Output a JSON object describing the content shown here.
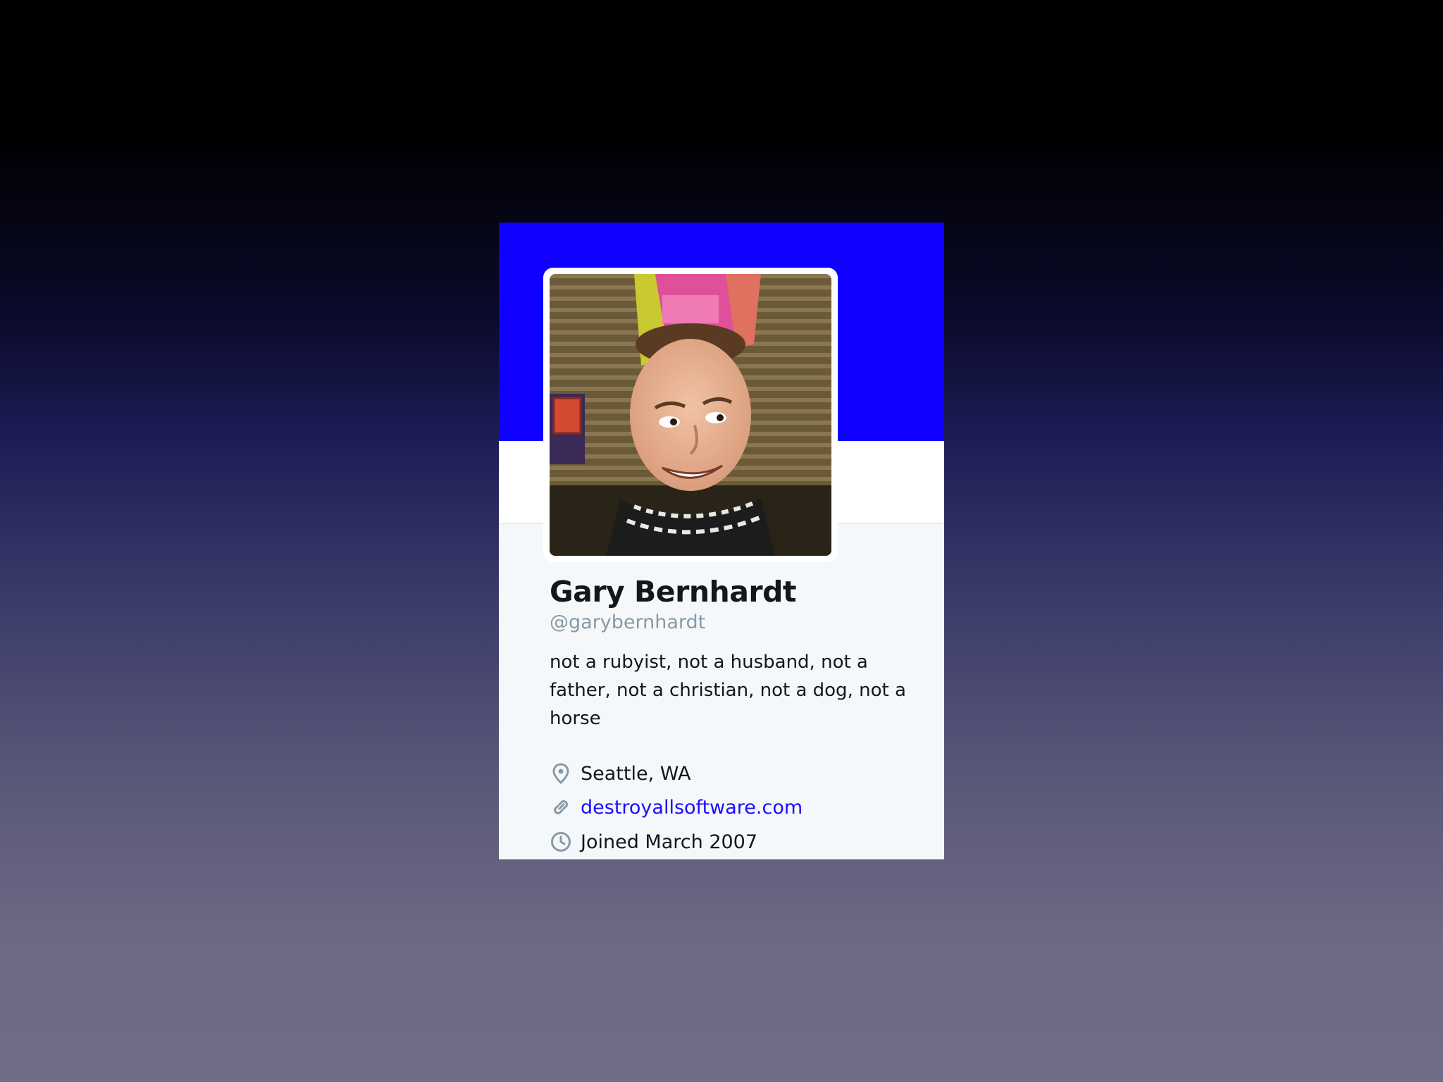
{
  "profile": {
    "name": "Gary Bernhardt",
    "handle": "@garybernhardt",
    "bio": "not a rubyist, not a husband, not a father, not a christian, not a dog, not a horse",
    "location": "Seattle, WA",
    "website": "destroyallsoftware.com",
    "joined": "Joined March 2007"
  },
  "icons": {
    "location": "map-pin-icon",
    "website": "link-icon",
    "joined": "clock-icon"
  },
  "colors": {
    "banner": "#0f00ff",
    "link": "#1a0dff",
    "card_background": "#f5f8fa",
    "handle": "#8899a6"
  }
}
